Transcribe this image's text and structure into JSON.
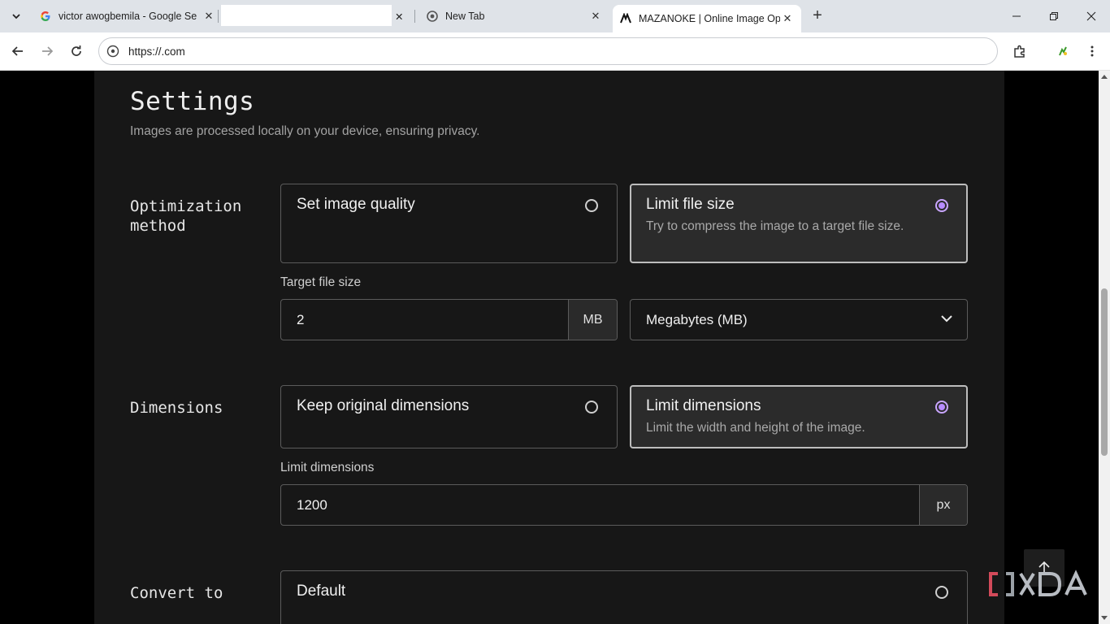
{
  "browser": {
    "tabs": [
      {
        "title": "victor awogbemila - Google Se",
        "active": false,
        "favicon": "google-icon"
      },
      {
        "title": "",
        "active": false,
        "favicon": ""
      },
      {
        "title": "New Tab",
        "active": false,
        "favicon": "chrome-icon"
      },
      {
        "title": "MAZANOKE | Online Image Op",
        "active": true,
        "favicon": "mazanoke-icon"
      }
    ],
    "url": "https://.com"
  },
  "page": {
    "title": "Settings",
    "subtitle": "Images are processed locally on your device, ensuring privacy.",
    "optimization": {
      "label": "Optimization method",
      "options": [
        {
          "title": "Set image quality",
          "desc": "",
          "selected": false
        },
        {
          "title": "Limit file size",
          "desc": "Try to compress the image to a target file size.",
          "selected": true
        }
      ],
      "target_label": "Target file size",
      "target_value": "2",
      "target_unit": "MB",
      "unit_select": "Megabytes (MB)"
    },
    "dimensions": {
      "label": "Dimensions",
      "options": [
        {
          "title": "Keep original dimensions",
          "desc": "",
          "selected": false
        },
        {
          "title": "Limit dimensions",
          "desc": "Limit the width and height of the image.",
          "selected": true
        }
      ],
      "limit_label": "Limit dimensions",
      "limit_value": "1200",
      "limit_unit": "px"
    },
    "convert": {
      "label": "Convert to",
      "option": {
        "title": "Default",
        "selected": false
      }
    }
  },
  "colors": {
    "accent": "#b78bff",
    "panel": "#171717",
    "background": "#000000"
  },
  "watermark": "XDA"
}
